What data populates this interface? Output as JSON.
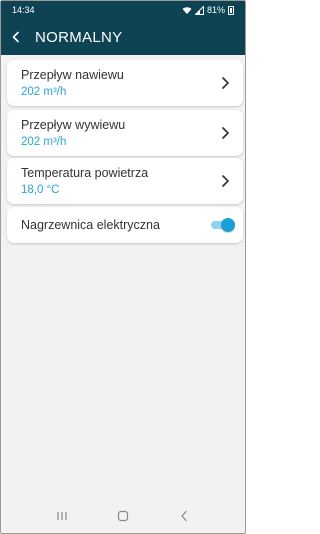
{
  "status_bar": {
    "time": "14:34",
    "battery": "81%",
    "icons": [
      "wifi-icon",
      "signal-icon",
      "battery-icon"
    ]
  },
  "app_bar": {
    "title": "NORMALNY",
    "back_icon": "chevron-left-icon"
  },
  "items": [
    {
      "label": "Przepływ nawiewu",
      "value": "202  m³/h",
      "control": "chevron-right-icon"
    },
    {
      "label": "Przepływ wywiewu",
      "value": "202  m³/h",
      "control": "chevron-right-icon"
    },
    {
      "label": "Temperatura powietrza",
      "value": "18,0  °C",
      "control": "chevron-right-icon"
    },
    {
      "label": "Nagrzewnica elektryczna",
      "toggle_on": true
    }
  ],
  "nav_bar": {
    "buttons": [
      "recent-apps-icon",
      "home-icon",
      "back-nav-icon"
    ]
  },
  "colors": {
    "header": "#0e4353",
    "accent": "#2aa4d6",
    "background": "#f2f2f2"
  }
}
